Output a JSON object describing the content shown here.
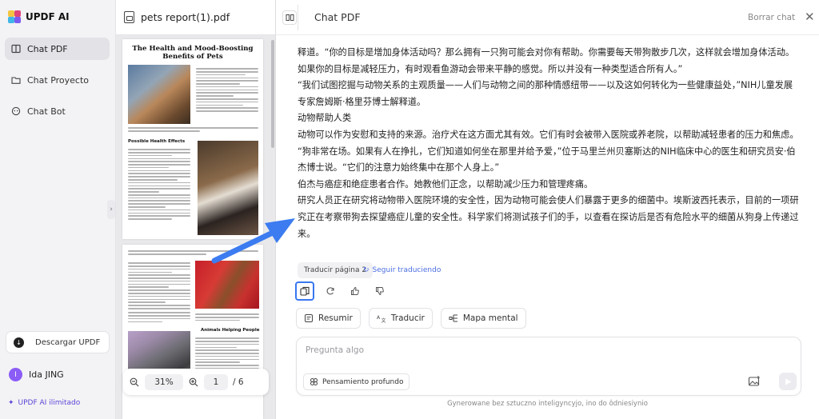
{
  "sidebar": {
    "brand": "UPDF AI",
    "nav": [
      {
        "label": "Chat PDF",
        "icon": "book-icon",
        "active": true
      },
      {
        "label": "Chat Proyecto",
        "icon": "folder-icon",
        "active": false
      },
      {
        "label": "Chat Bot",
        "icon": "bot-icon",
        "active": false
      }
    ],
    "download_label": "Descargar UPDF",
    "user": {
      "initial": "I",
      "name": "Ida JING"
    },
    "upgrade_label": "UPDF AI ilimitado"
  },
  "pdf": {
    "filename": "pets report(1).pdf",
    "page_title": "The Health and Mood-Boosting Benefits of Pets",
    "section_possible": "Possible Health Effects",
    "section_animals": "Animals Helping People",
    "zoom": "31%",
    "current_page": "1",
    "total_pages": "/ 6"
  },
  "chat": {
    "title": "Chat PDF",
    "clear_label": "Borrar chat",
    "paragraphs": [
      "释道。“你的目标是增加身体活动吗？那么拥有一只狗可能会对你有帮助。你需要每天带狗散步几次，这样就会增加身体活动。如果你的目标是减轻压力，有时观看鱼游动会带来平静的感觉。所以并没有一种类型适合所有人。”",
      "“我们试图挖掘与动物关系的主观质量——人们与动物之间的那种情感纽带——以及这如何转化为一些健康益处，”NIH儿童发展专家詹姆斯·格里芬博士解释道。",
      "动物帮助人类",
      "动物可以作为安慰和支持的来源。治疗犬在这方面尤其有效。它们有时会被带入医院或养老院，以帮助减轻患者的压力和焦虑。",
      "“狗非常在场。如果有人在挣扎，它们知道如何坐在那里并给予爱，”位于马里兰州贝塞斯达的NIH临床中心的医生和研究员安·伯杰博士说。“它们的注意力始终集中在那个人身上。”",
      "伯杰与癌症和绝症患者合作。她教他们正念，以帮助减少压力和管理疼痛。",
      "研究人员正在研究将动物带入医院环境的安全性，因为动物可能会使人们暴露于更多的细菌中。埃斯波西托表示，目前的一项研究正在考察带狗去探望癌症儿童的安全性。科学家们将测试孩子们的手，以查看在探访后是否有危险水平的细菌从狗身上传递过来。"
    ],
    "translate_chip": "Traducir página 2",
    "follow_label": "Seguir traduciendo",
    "pills": [
      "Resumir",
      "Traducir",
      "Mapa mental"
    ],
    "input_placeholder": "Pregunta algo",
    "think_label": "Pensamiento profundo",
    "disclaimer": "Gynerowane bez sztuczno inteligyncyjo, ino do ôdniesiynio"
  },
  "colors": {
    "accent": "#3777f0",
    "upgrade": "#5b46d6",
    "active_nav": "#e2e2e7"
  }
}
